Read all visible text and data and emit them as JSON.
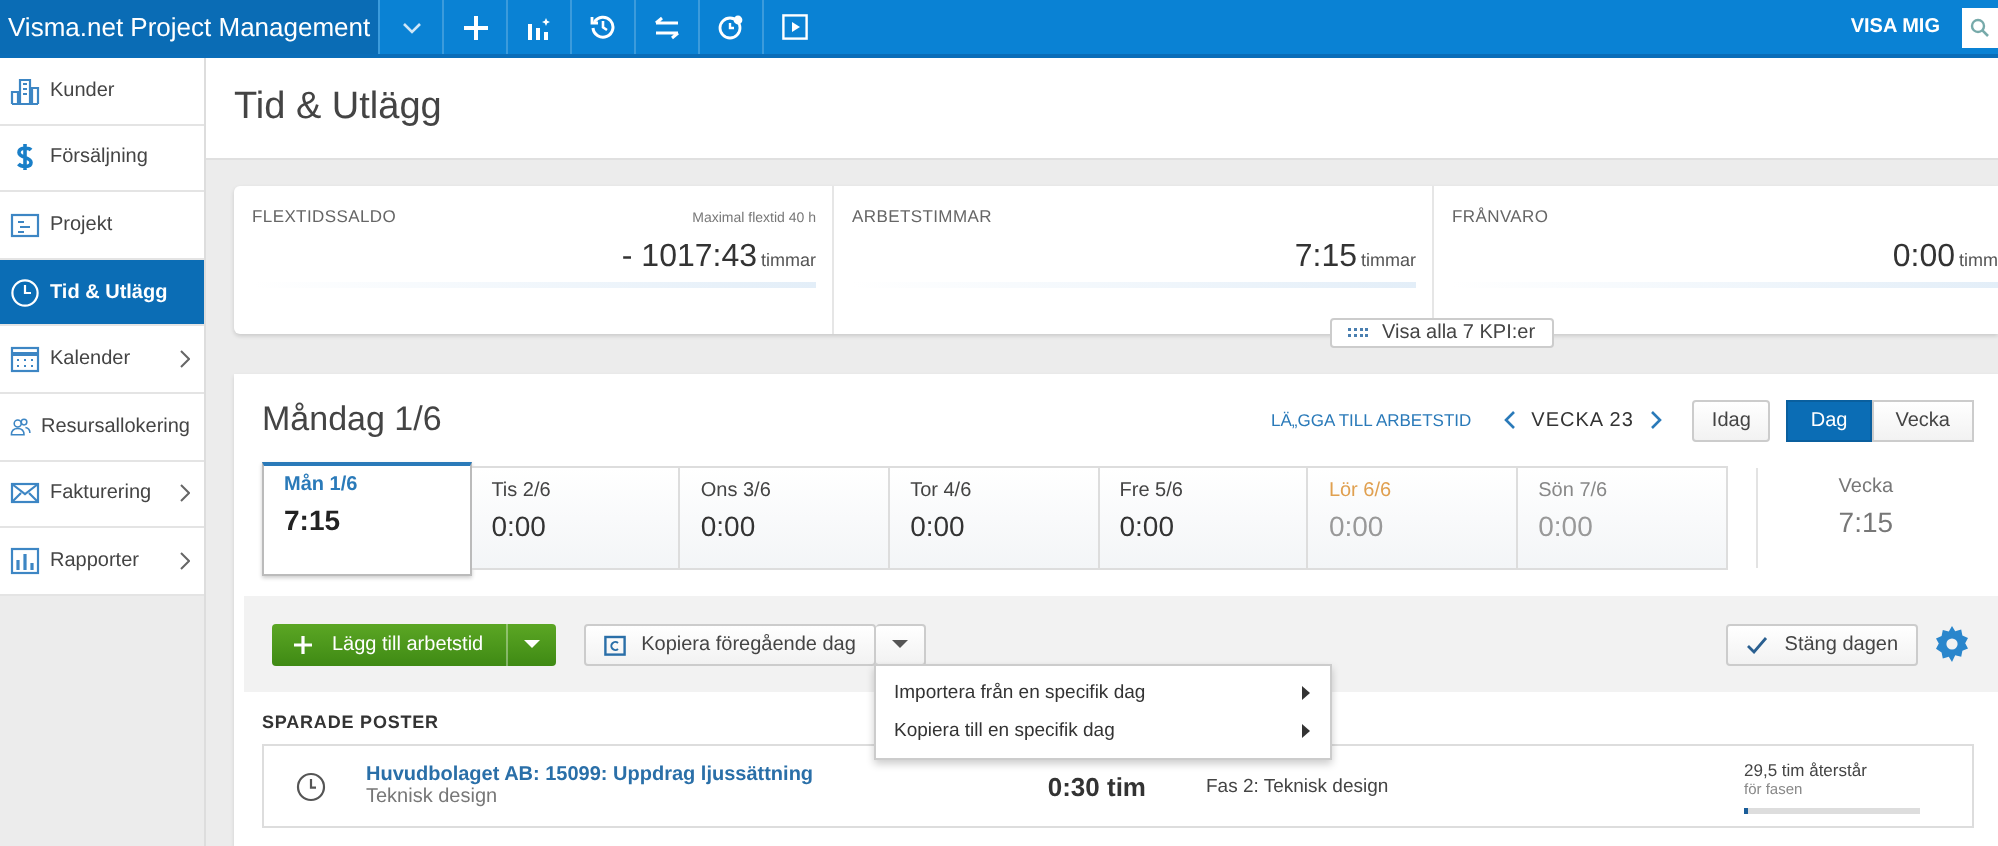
{
  "topbar": {
    "app_name": "Visma.net Project Management",
    "toolbar_icons": [
      {
        "kind": "caret"
      },
      {
        "kind": "plus"
      },
      {
        "kind": "chart"
      },
      {
        "kind": "history"
      },
      {
        "kind": "swap"
      },
      {
        "kind": "timer"
      },
      {
        "kind": "play"
      }
    ],
    "user_label": "VISA MIG"
  },
  "sidebar": {
    "items": [
      {
        "label": "Kunder",
        "selected": false,
        "expandable": false
      },
      {
        "label": "Försäljning",
        "selected": false,
        "expandable": false
      },
      {
        "label": "Projekt",
        "selected": false,
        "expandable": false
      },
      {
        "label": "Tid & Utlägg",
        "selected": true,
        "expandable": false
      },
      {
        "label": "Kalender",
        "selected": false,
        "expandable": true
      },
      {
        "label": "Resursallokering",
        "selected": false,
        "expandable": false
      },
      {
        "label": "Fakturering",
        "selected": false,
        "expandable": true
      },
      {
        "label": "Rapporter",
        "selected": false,
        "expandable": true
      }
    ]
  },
  "page_title": "Tid & Utlägg",
  "kpis": [
    {
      "label": "FLEXTIDSSALDO",
      "note": "Maximal flextid 40 h",
      "value": "- 1017:43",
      "unit": "timmar"
    },
    {
      "label": "ARBETSTIMMAR",
      "value": "7:15",
      "unit": "timmar"
    },
    {
      "label": "FRÅNVARO",
      "value": "0:00",
      "unit": "timm"
    }
  ],
  "kpi_toggle": "Visa alla 7 KPI:er",
  "day_view": {
    "title": "Måndag 1/6",
    "lock_link": "LÄ„GGA TILL ARBETSTID",
    "week_label": "VECKA 23",
    "today_button": "Idag",
    "view_toggle": [
      {
        "label": "Dag",
        "selected": true
      },
      {
        "label": "Vecka",
        "selected": false
      }
    ],
    "days": [
      {
        "label": "Mån 1/6",
        "value": "7:15",
        "selected": true,
        "kind": "weekday"
      },
      {
        "label": "Tis 2/6",
        "value": "0:00",
        "selected": false,
        "kind": "weekday"
      },
      {
        "label": "Ons 3/6",
        "value": "0:00",
        "selected": false,
        "kind": "weekday"
      },
      {
        "label": "Tor 4/6",
        "value": "0:00",
        "selected": false,
        "kind": "weekday"
      },
      {
        "label": "Fre 5/6",
        "value": "0:00",
        "selected": false,
        "kind": "weekday"
      },
      {
        "label": "Lör 6/6",
        "value": "0:00",
        "selected": false,
        "kind": "saturday"
      },
      {
        "label": "Sön 7/6",
        "value": "0:00",
        "selected": false,
        "kind": "sunday"
      }
    ],
    "week_total": {
      "label": "Vecka",
      "value": "7:15"
    },
    "add_button": "Lägg till arbetstid",
    "copy_button": "Kopiera föregående dag",
    "close_day_button": "Stäng dagen",
    "copy_menu": [
      {
        "label": "Importera från en specifik dag"
      },
      {
        "label": "Kopiera till en specifik dag"
      }
    ],
    "saved_title": "SPARADE POSTER",
    "entries": [
      {
        "title": "Huvudbolaget AB: 15099: Uppdrag ljussättning",
        "subtitle": "Teknisk design",
        "hours": "0:30 tim",
        "phase": "Fas 2: Teknisk design",
        "remaining": "29,5 tim återstår",
        "remaining_note": "för fasen",
        "level": 0.02
      }
    ]
  }
}
